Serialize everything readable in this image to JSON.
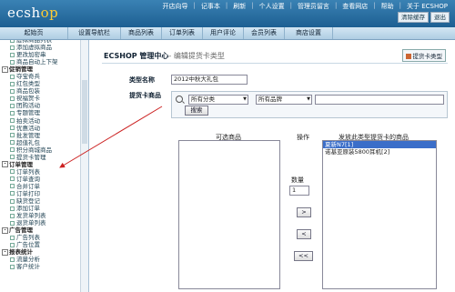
{
  "app": {
    "logo_main": "ecsh",
    "logo_accent": "op"
  },
  "toplinks": [
    "开店向导",
    "记事本",
    "刷新",
    "个人设置",
    "管理员留言",
    "查看网店",
    "帮助",
    "关于 ECSHOP"
  ],
  "small_buttons": [
    "清除缓存",
    "退出"
  ],
  "nav": [
    "起始页",
    "设置导航栏",
    "商品列表",
    "订单列表",
    "用户评论",
    "会员列表",
    "商店设置"
  ],
  "sidebar": [
    {
      "t": "it",
      "label": "虚拟商品列表"
    },
    {
      "t": "it",
      "label": "添加虚拟商品"
    },
    {
      "t": "it",
      "label": "更改加密串"
    },
    {
      "t": "it",
      "label": "商品自动上下架"
    },
    {
      "t": "g",
      "label": "促销管理"
    },
    {
      "t": "it",
      "label": "夺宝奇兵"
    },
    {
      "t": "it",
      "label": "红包类型"
    },
    {
      "t": "it",
      "label": "商品包装"
    },
    {
      "t": "it",
      "label": "祝福贺卡"
    },
    {
      "t": "it",
      "label": "团购活动"
    },
    {
      "t": "it",
      "label": "专题管理"
    },
    {
      "t": "it",
      "label": "拍卖活动"
    },
    {
      "t": "it",
      "label": "优惠活动"
    },
    {
      "t": "it",
      "label": "批发管理"
    },
    {
      "t": "it",
      "label": "超值礼包"
    },
    {
      "t": "it",
      "label": "积分商城商品"
    },
    {
      "t": "it",
      "label": "提货卡管理"
    },
    {
      "t": "g",
      "label": "订单管理"
    },
    {
      "t": "it",
      "label": "订单列表"
    },
    {
      "t": "it",
      "label": "订单查询"
    },
    {
      "t": "it",
      "label": "合并订单"
    },
    {
      "t": "it",
      "label": "订单打印"
    },
    {
      "t": "it",
      "label": "缺货登记"
    },
    {
      "t": "it",
      "label": "添加订单"
    },
    {
      "t": "it",
      "label": "发货单列表"
    },
    {
      "t": "it",
      "label": "退货单列表"
    },
    {
      "t": "g",
      "label": "广告管理"
    },
    {
      "t": "it",
      "label": "广告列表"
    },
    {
      "t": "it",
      "label": "广告位置"
    },
    {
      "t": "g",
      "label": "报表统计"
    },
    {
      "t": "it",
      "label": "流量分析"
    },
    {
      "t": "it",
      "label": "客户统计"
    }
  ],
  "main": {
    "title": "ECSHOP 管理中心",
    "subtitle": "- 编辑提货卡类型",
    "list_button": "提货卡类型",
    "type_name_label": "类型名称",
    "type_name_value": "2012中秋大礼包",
    "goods_label": "提货卡商品",
    "category_select": "所有分类",
    "brand_select": "所有品牌",
    "search_button": "搜索",
    "available_header": "可选商品",
    "operation_header": "操作",
    "selected_header": "发放此类型提货卡的商品",
    "quantity_label": "数量",
    "quantity_value": "1",
    "op_buttons": [
      ">",
      "<",
      "<<"
    ],
    "selected_items": [
      "夏新N7[1]",
      "诺基亚原装5800耳机[2]"
    ]
  },
  "colors": {
    "header": "#1d5f92",
    "nav": "#c4dcec",
    "arrow": "#cc2222",
    "selection": "#3b6ec9"
  }
}
